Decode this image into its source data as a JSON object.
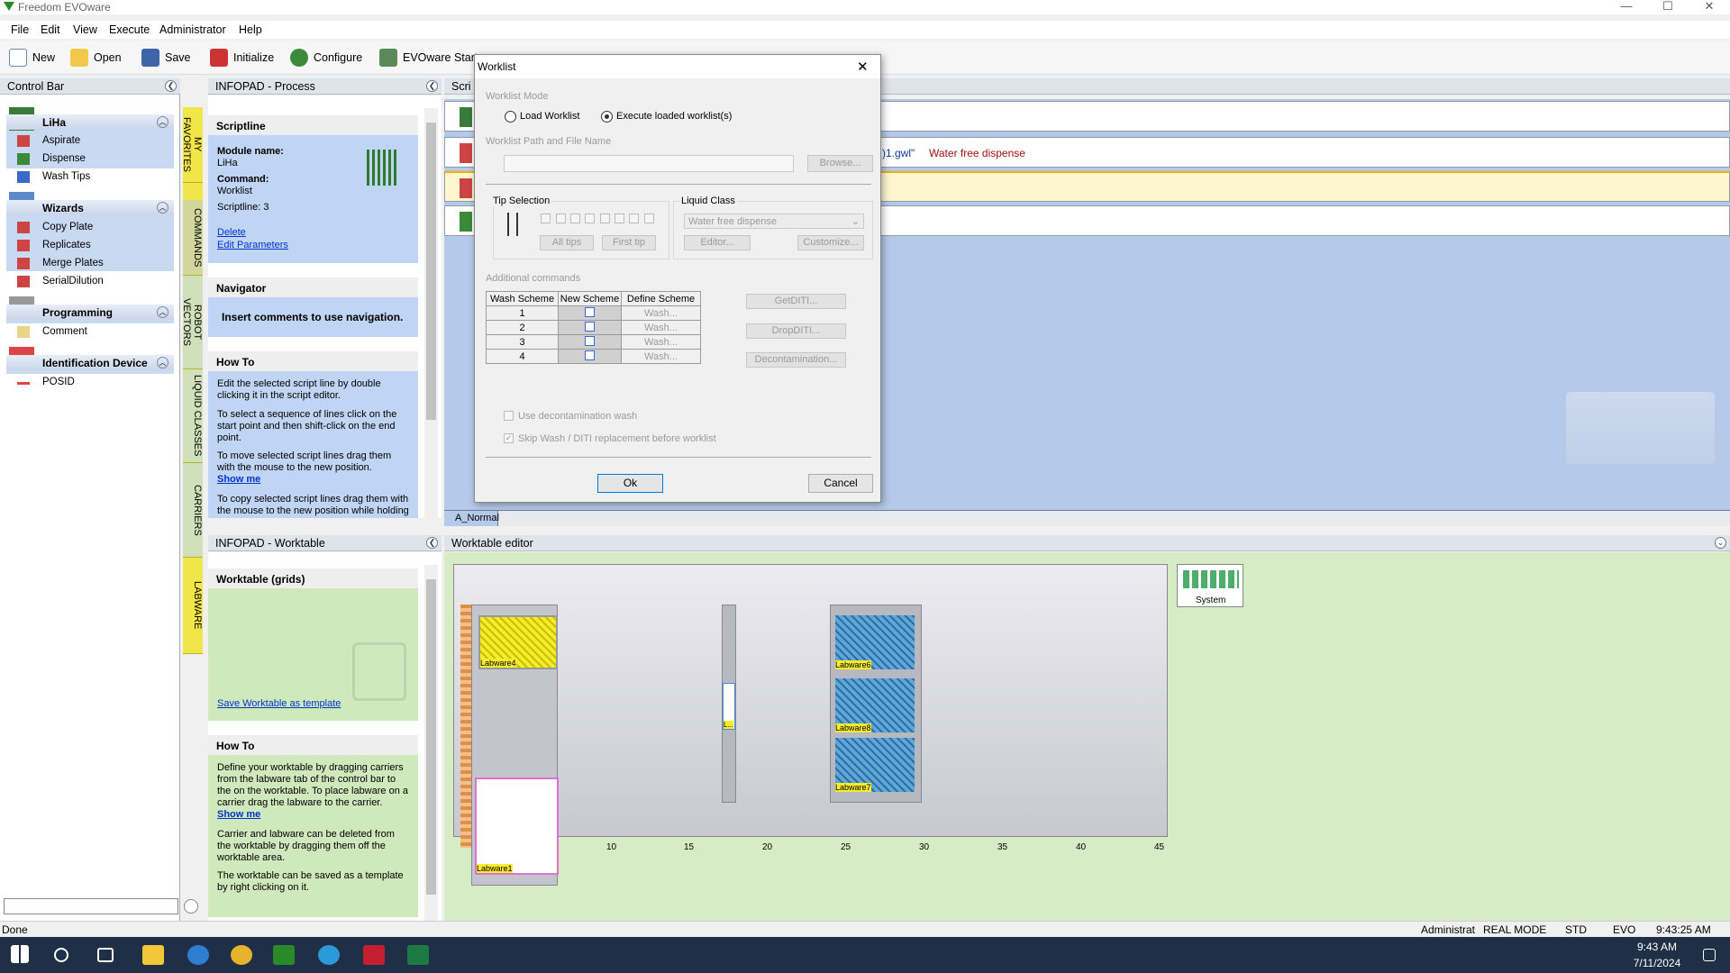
{
  "window": {
    "title": "Freedom EVOware"
  },
  "menu": [
    "File",
    "Edit",
    "View",
    "Execute",
    "Administrator",
    "Help"
  ],
  "toolbar": {
    "new": "New",
    "open": "Open",
    "save": "Save",
    "initialize": "Initialize",
    "configure": "Configure",
    "evoware_start": "EVOware Start"
  },
  "control_bar": {
    "title": "Control Bar",
    "groups": [
      {
        "label": "LiHa",
        "items": [
          "Aspirate",
          "Dispense",
          "Wash Tips"
        ]
      },
      {
        "label": "Wizards",
        "items": [
          "Copy Plate",
          "Replicates",
          "Merge Plates",
          "SerialDilution"
        ]
      },
      {
        "label": "Programming",
        "items": [
          "Comment"
        ]
      },
      {
        "label": "Identification Device",
        "items": [
          "POSID"
        ]
      }
    ]
  },
  "vertical_tabs": [
    "MY FAVORITES",
    "COMMANDS",
    "ROBOT VECTORS",
    "LIQUID CLASSES",
    "CARRIERS",
    "LABWARE"
  ],
  "infopad_process": {
    "title": "INFOPAD - Process",
    "scriptline": {
      "heading": "Scriptline",
      "module_label": "Module name:",
      "module_value": "LiHa",
      "command_label": "Command:",
      "command_value": "Worklist",
      "scriptline_text": "Scriptline: 3",
      "delete_link": "Delete",
      "edit_link": "Edit Parameters"
    },
    "navigator": {
      "heading": "Navigator",
      "text": "Insert comments to use navigation."
    },
    "howto": {
      "heading": "How To",
      "p1": "Edit the selected script line by double clicking it in the script editor.",
      "p2": "To select a sequence of lines click on the start point and then shift-click on the end point.",
      "p3": "To move selected script lines drag them with the mouse to the new position.",
      "show_me": "Show me",
      "p4": "To copy selected script lines drag them with the mouse to the new position while holding"
    }
  },
  "script_editor": {
    "header": "Scri",
    "line2_text": ")1.gwl\"",
    "line2_liquid": "Water free dispense",
    "tab": "A_Normal"
  },
  "worklist_dialog": {
    "title": "Worklist",
    "mode_label": "Worklist Mode",
    "load_worklist": "Load Worklist",
    "execute_loaded": "Execute loaded worklist(s)",
    "path_label": "Worklist Path and File Name",
    "browse": "Browse...",
    "tip_selection": "Tip Selection",
    "all_tips": "All tips",
    "first_tip": "First tip",
    "liquid_class": "Liquid Class",
    "liquid_class_value": "Water free dispense",
    "editor": "Editor...",
    "customize": "Customize...",
    "additional_commands": "Additional commands",
    "table_headers": [
      "Wash Scheme",
      "New Scheme",
      "Define Scheme"
    ],
    "rows": [
      "1",
      "2",
      "3",
      "4"
    ],
    "wash_btn": "Wash...",
    "get_diti": "GetDITI...",
    "drop_diti": "DropDITI...",
    "decontamination": "Decontamination...",
    "use_decon": "Use decontamination wash",
    "skip_wash": "Skip Wash / DITI replacement before worklist",
    "ok": "Ok",
    "cancel": "Cancel"
  },
  "infopad_worktable": {
    "title": "INFOPAD - Worktable",
    "grids_heading": "Worktable (grids)",
    "save_template": "Save Worktable as template",
    "howto_heading": "How To",
    "p1": "Define your worktable by dragging carriers from the labware tab of the control bar to the on the worktable. To place labware on a carrier drag the labware to the carrier.",
    "show_me": "Show me",
    "p2": "Carrier and labware can be deleted from the worktable by dragging them off the worktable area.",
    "p3": "The worktable can be saved as a template by right clicking on it."
  },
  "worktable_editor": {
    "title": "Worktable editor",
    "labware": [
      "Labware4",
      "Labware1",
      "Labware6",
      "Labware8",
      "Labware7",
      "L..."
    ],
    "system": "System",
    "ruler": [
      "10",
      "15",
      "20",
      "25",
      "30",
      "35",
      "40",
      "45"
    ]
  },
  "status_bar": {
    "left": "Done",
    "user": "Administrat",
    "mode": "REAL MODE",
    "std": "STD",
    "evo": "EVO",
    "time": "9:43:25 AM"
  },
  "taskbar": {
    "time": "9:43 AM",
    "date": "7/11/2024"
  },
  "colors": {
    "selection_blue": "#c9d9f2",
    "tab_yellow": "#f0e64a",
    "worktable_green": "#d6ecc4",
    "labware_yellow": "#f5ec30",
    "labware_blue": "#5fa7d8"
  }
}
